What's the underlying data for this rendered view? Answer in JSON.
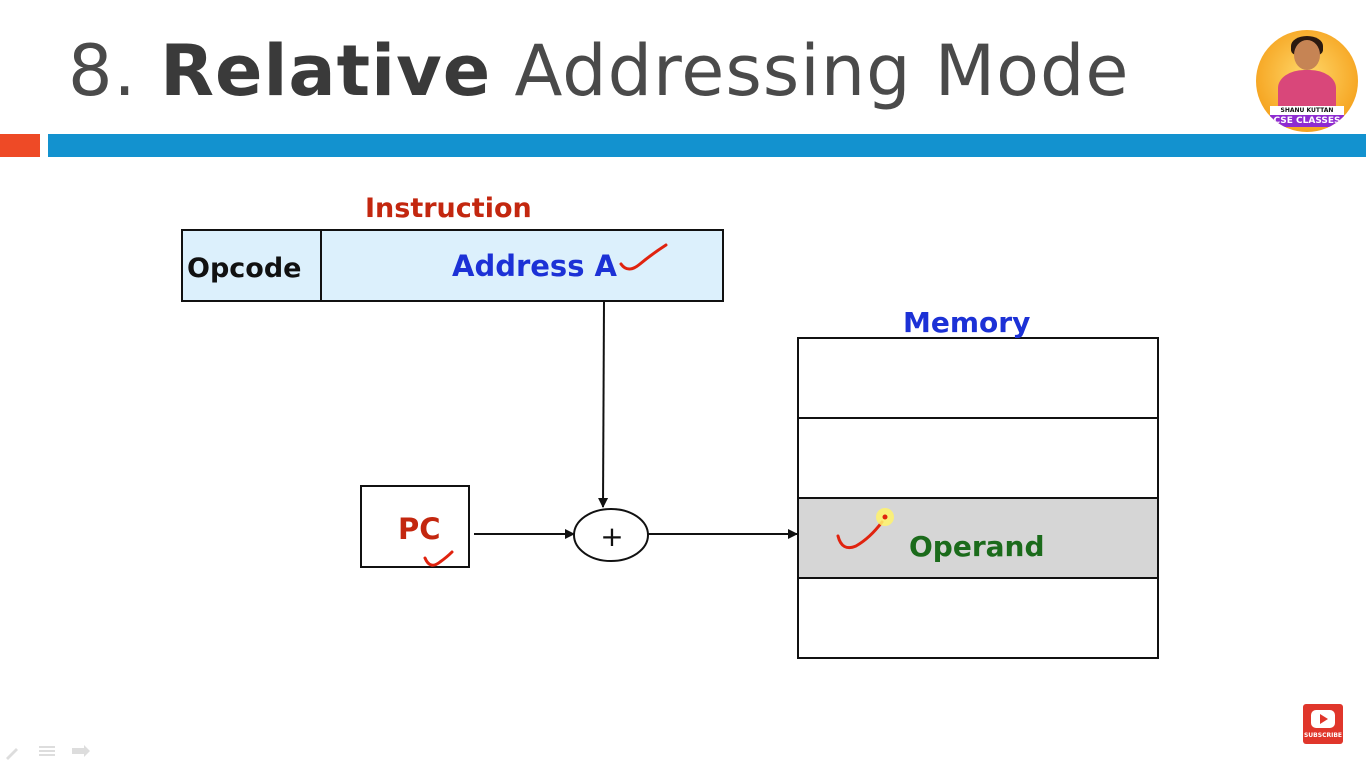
{
  "slide": {
    "title_number": "8.",
    "title_bold": "Relative",
    "title_rest": "Addressing Mode"
  },
  "logo": {
    "name": "SHANU KUTTAN",
    "brand": "CSE CLASSES"
  },
  "diagram": {
    "instruction_label": "Instruction",
    "opcode_label": "Opcode",
    "address_label": "Address A",
    "memory_label": "Memory",
    "pc_label": "PC",
    "adder_symbol": "+",
    "operand_label": "Operand"
  },
  "subscribe": {
    "label": "SUBSCRIBE"
  },
  "colors": {
    "accent_orange": "#ee4a26",
    "accent_blue": "#1392cf",
    "instruction_fill": "#dcf0fc",
    "operand_fill": "#d6d6d6",
    "annotation_red": "#e0230f"
  }
}
